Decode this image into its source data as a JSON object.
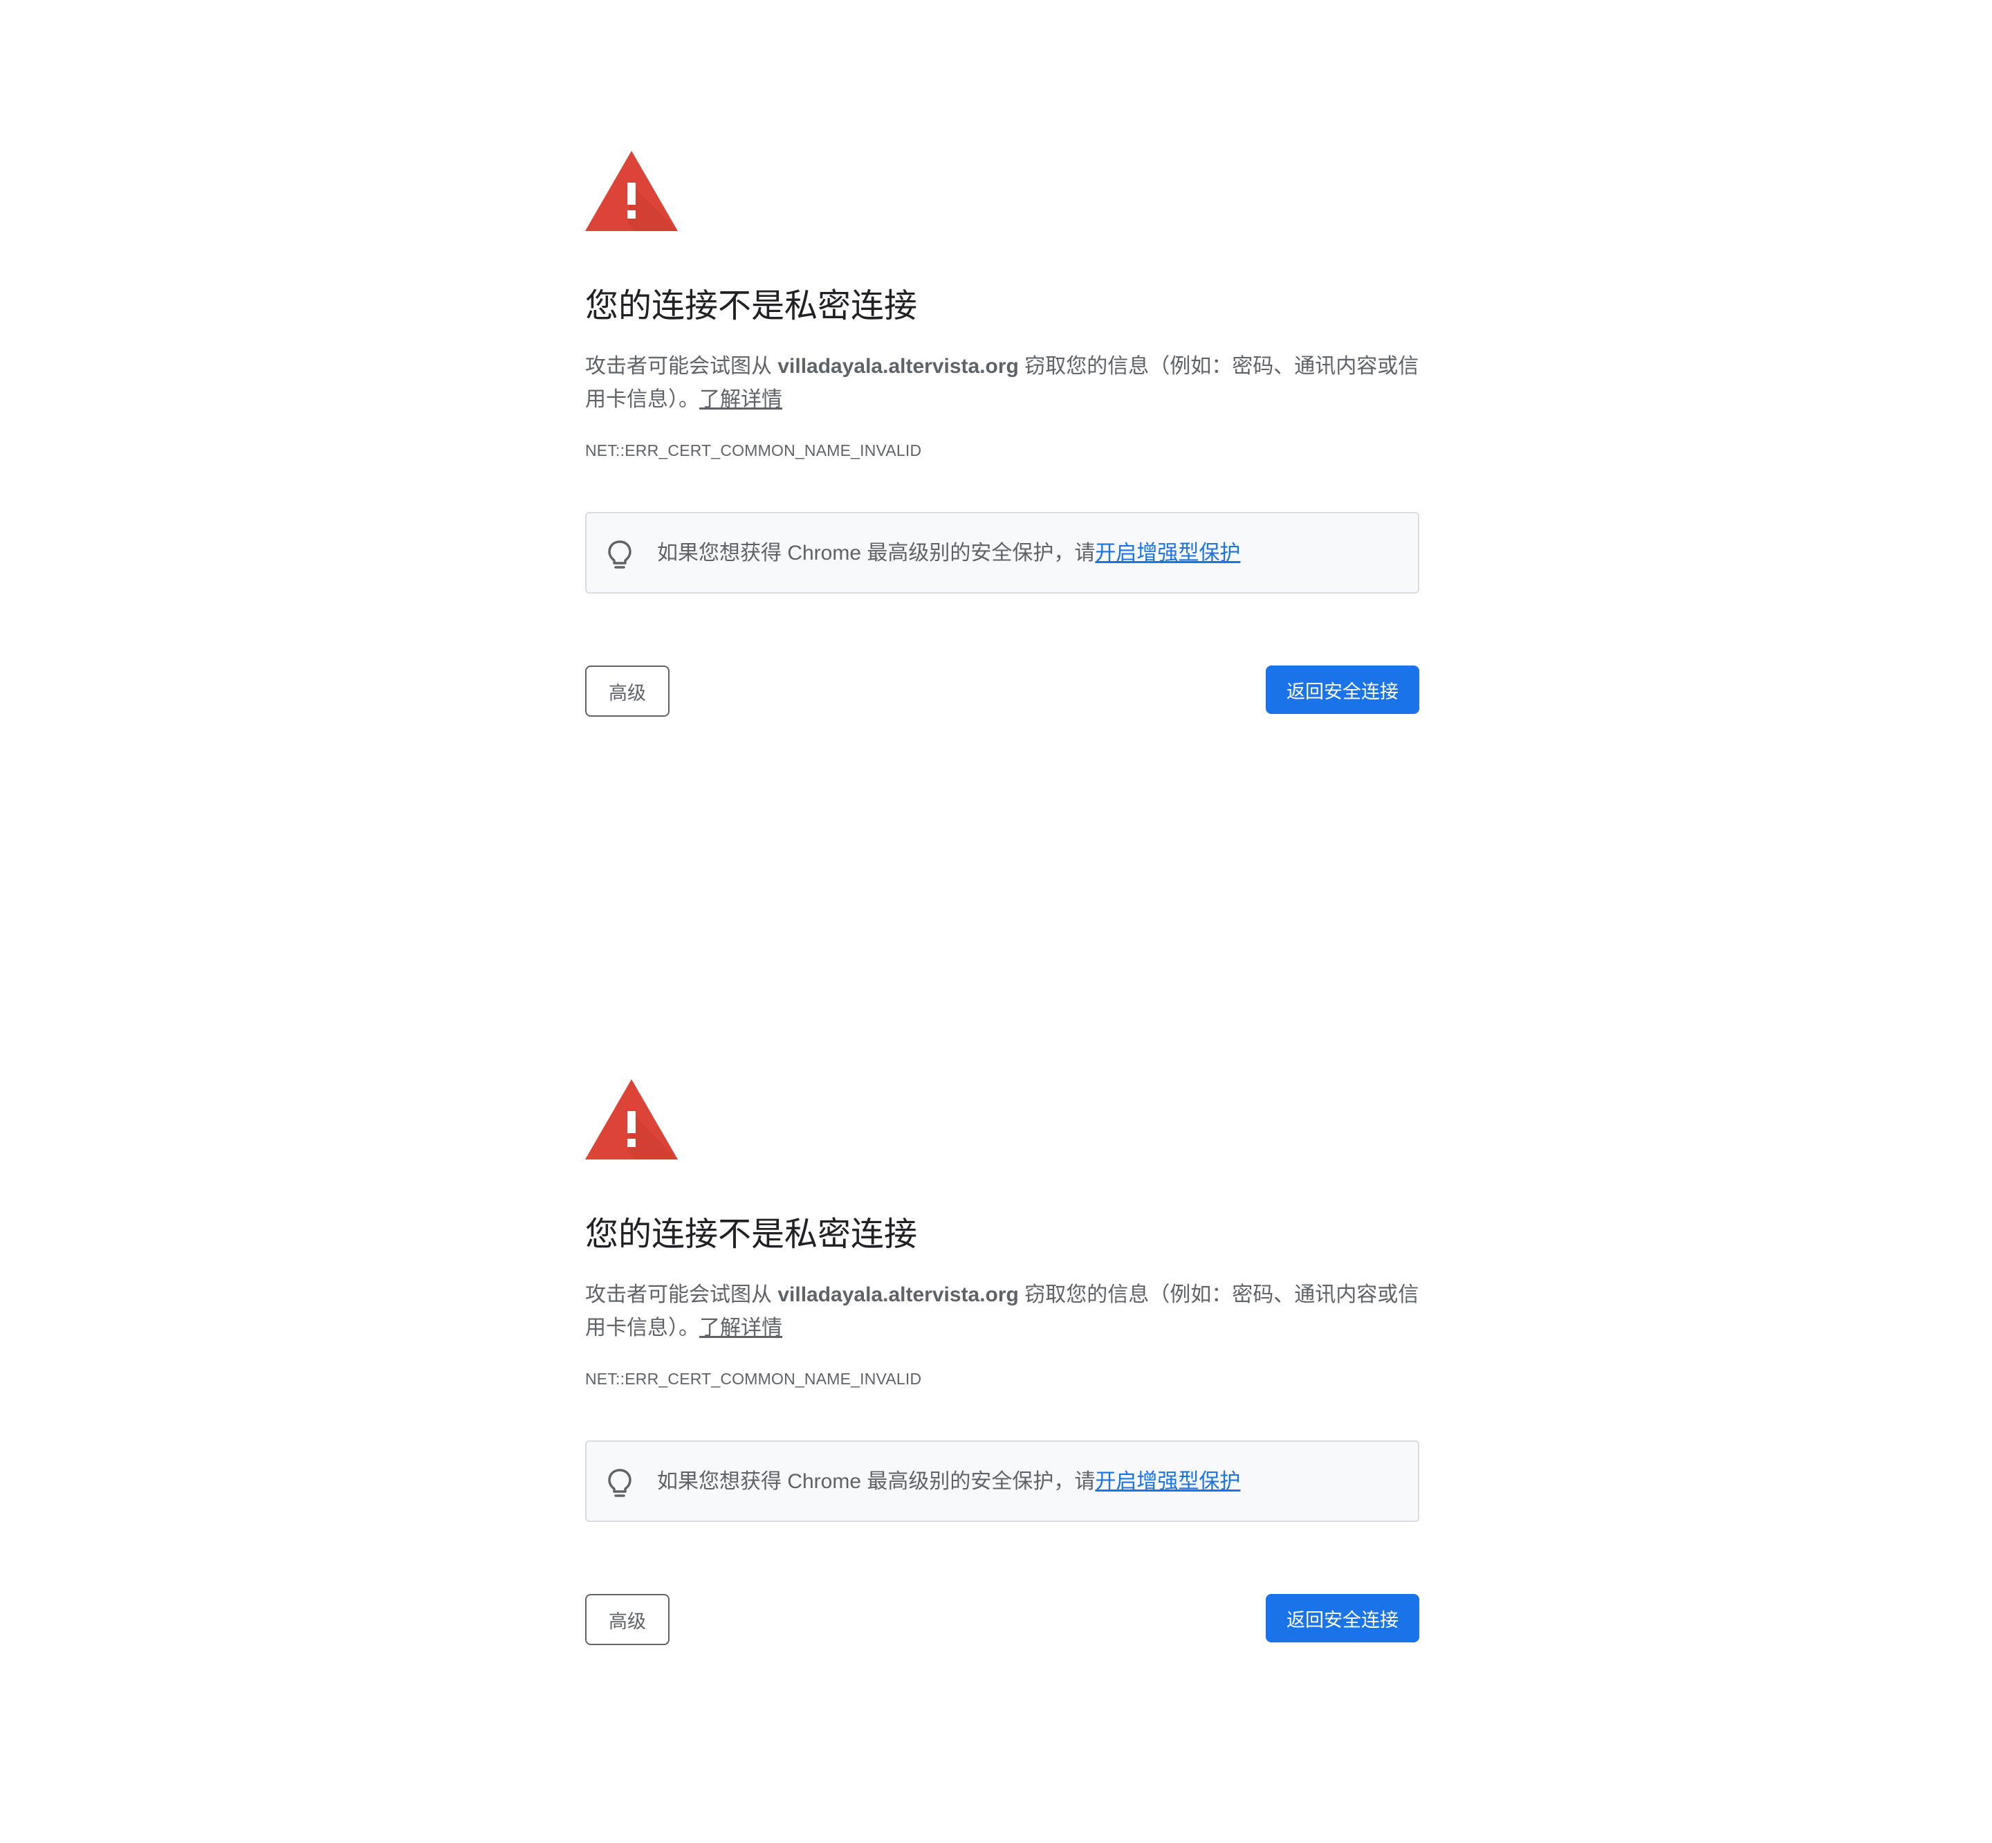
{
  "colors": {
    "warning_red": "#db4437",
    "primary_blue": "#1a73e8",
    "text_gray": "#5f6368",
    "heading": "#202124",
    "box_background": "#f8f9fa",
    "box_border": "#dadce0"
  },
  "icons": {
    "warning": "warning-triangle-icon",
    "tip": "lightbulb-icon"
  },
  "interstitials": [
    {
      "heading": "您的连接不是私密连接",
      "explanation_prefix": "攻击者可能会试图从 ",
      "domain": "villadayala.altervista.org",
      "explanation_suffix": " 窃取您的信息（例如：密码、通讯内容或信用卡信息）。",
      "learn_more": "了解详情",
      "error_code": "NET::ERR_CERT_COMMON_NAME_INVALID",
      "enhanced_text": "如果您想获得 Chrome 最高级别的安全保护，请",
      "enhanced_link": "开启增强型保护",
      "advanced_button": "高级",
      "back_button": "返回安全连接"
    },
    {
      "heading": "您的连接不是私密连接",
      "explanation_prefix": "攻击者可能会试图从 ",
      "domain": "villadayala.altervista.org",
      "explanation_suffix": " 窃取您的信息（例如：密码、通讯内容或信用卡信息）。",
      "learn_more": "了解详情",
      "error_code": "NET::ERR_CERT_COMMON_NAME_INVALID",
      "enhanced_text": "如果您想获得 Chrome 最高级别的安全保护，请",
      "enhanced_link": "开启增强型保护",
      "advanced_button": "高级",
      "back_button": "返回安全连接"
    }
  ]
}
